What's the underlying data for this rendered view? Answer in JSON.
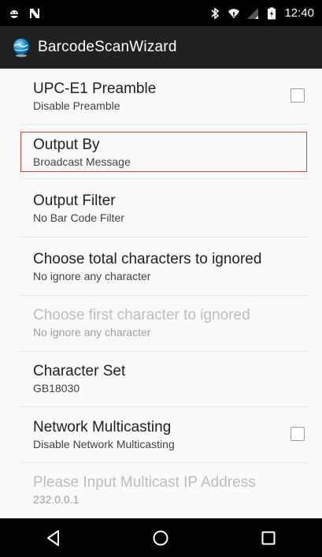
{
  "status_bar": {
    "left_icons": [
      "android-notification-icon",
      "n-notification-icon"
    ],
    "right_icons": [
      "bluetooth-icon",
      "wifi-icon",
      "signal-icon",
      "battery-icon"
    ],
    "time": "12:40"
  },
  "action_bar": {
    "app_icon": "globe-app-icon",
    "title": "BarcodeScanWizard"
  },
  "preferences": [
    {
      "title": "UPC-E1 Preamble",
      "summary": "Disable Preamble",
      "has_checkbox": true,
      "checked": false,
      "enabled": true
    },
    {
      "title": "Output By",
      "summary": "Broadcast Message",
      "has_checkbox": false,
      "enabled": true,
      "highlighted": true
    },
    {
      "title": "Output Filter",
      "summary": "No Bar Code Filter",
      "has_checkbox": false,
      "enabled": true
    },
    {
      "title": "Choose total characters to ignored",
      "summary": "No ignore any character",
      "has_checkbox": false,
      "enabled": true
    },
    {
      "title": "Choose first character to ignored",
      "summary": "No ignore any character",
      "has_checkbox": false,
      "enabled": false
    },
    {
      "title": "Character Set",
      "summary": "GB18030",
      "has_checkbox": false,
      "enabled": true
    },
    {
      "title": "Network Multicasting",
      "summary": "Disable Network Multicasting",
      "has_checkbox": true,
      "checked": false,
      "enabled": true
    },
    {
      "title": "Please Input Multicast IP Address",
      "summary": "232.0.0.1",
      "has_checkbox": false,
      "enabled": false
    }
  ],
  "nav_bar": {
    "buttons": [
      "back-icon",
      "home-icon",
      "recents-icon"
    ]
  },
  "colors": {
    "status_bar": "#000000",
    "action_bar": "#212121",
    "background": "#fafafa",
    "highlight_border": "#e53935"
  }
}
